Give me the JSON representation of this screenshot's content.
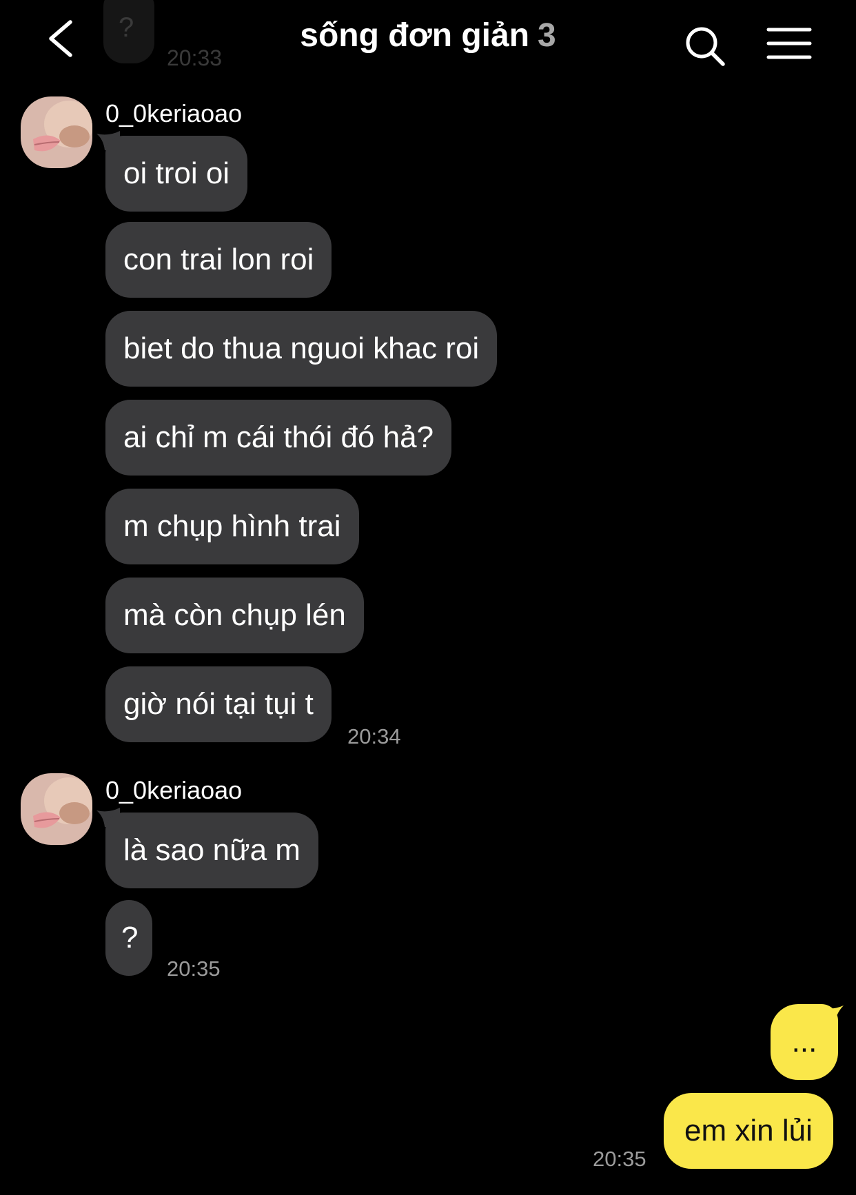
{
  "header": {
    "title": "sống đơn giản",
    "member_count": "3",
    "back_icon": "chevron-left-icon",
    "search_icon": "search-icon",
    "menu_icon": "hamburger-menu-icon"
  },
  "prev_message": {
    "text": "?",
    "time": "20:33"
  },
  "groups": [
    {
      "sender": "0_0keriaoao",
      "messages": [
        "oi troi oi",
        "con trai lon roi",
        "biet do thua nguoi khac roi",
        "ai chỉ m cái thói đó hả?",
        "m chụp hình trai",
        "mà còn chụp lén",
        "giờ nói tại tụi t"
      ],
      "time": "20:34"
    },
    {
      "sender": "0_0keriaoao",
      "messages": [
        "là sao nữa m",
        "?"
      ],
      "time": "20:35"
    }
  ],
  "my_messages": {
    "messages": [
      "...",
      "em xin lủi"
    ],
    "time": "20:35"
  },
  "colors": {
    "background": "#000000",
    "incoming_bubble": "#3a3a3c",
    "outgoing_bubble": "#fae74a",
    "timestamp": "#9b9b9b",
    "title_count": "#a7a7a7"
  }
}
